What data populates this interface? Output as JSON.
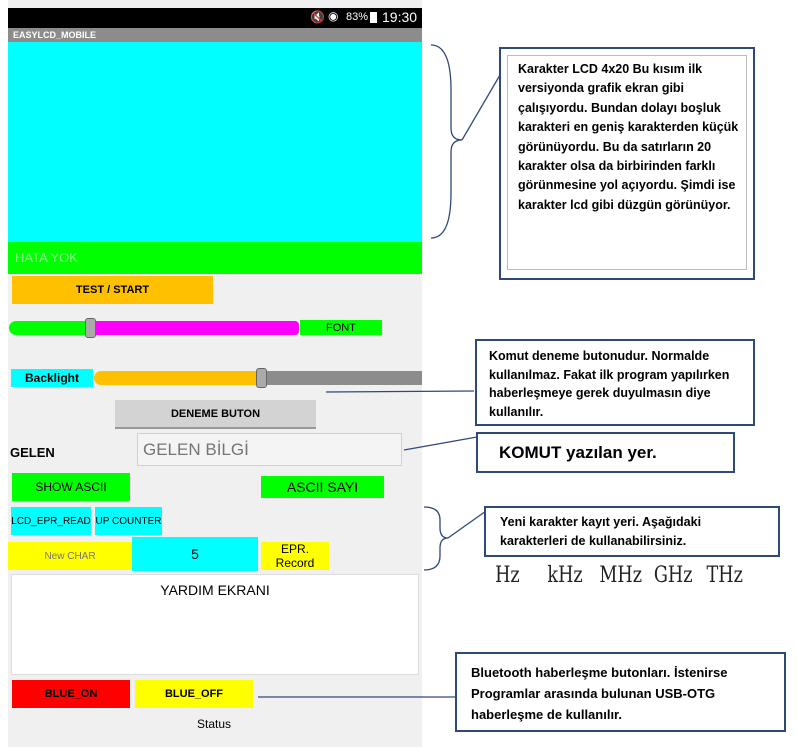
{
  "statusbar": {
    "battery": "83%",
    "time": "19:30"
  },
  "app": {
    "title": "EASYLCD_MOBILE"
  },
  "error": {
    "text": "HATA YOK"
  },
  "buttons": {
    "test_start": "TEST / START",
    "font": "FONT",
    "deneme": "DENEME BUTON",
    "show_ascii": "SHOW ASCII",
    "ascii_sayi": "ASCII SAYI",
    "lcd_epr_read": "LCD_EPR_READ",
    "up_counter": "UP COUNTER",
    "new_char": "New CHAR",
    "epr_record": "EPR. Record",
    "blue_on": "BLUE_ON",
    "blue_off": "BLUE_OFF"
  },
  "labels": {
    "backlight": "Backlight",
    "gelen": "GELEN",
    "yardim": "YARDIM EKRANI",
    "status": "Status"
  },
  "inputs": {
    "gelen_placeholder": "GELEN BİLGİ",
    "counter_value": "5"
  },
  "sliders": {
    "font_level": 0.28,
    "backlight_level": 0.51
  },
  "units": [
    "Hz",
    "kHz",
    "MHz",
    "GHz",
    "THz"
  ],
  "callouts": {
    "lcd": "Karakter LCD 4x20  Bu kısım ilk versiyonda grafik ekran gibi çalışıyordu. Bundan dolayı boşluk karakteri en geniş karakterden küçük görünüyordu. Bu da satırların 20 karakter olsa da birbirinden farklı görünmesine yol açıyordu. Şimdi ise karakter lcd gibi düzgün görünüyor.",
    "deneme": "Komut deneme butonudur. Normalde kullanılmaz. Fakat ilk program yapılırken haberleşmeye gerek duyulmasın diye kullanılır.",
    "komut": "KOMUT yazılan yer.",
    "karakter": "Yeni karakter kayıt yeri. Aşağıdaki karakterleri  de kullanabilirsiniz.",
    "bluetooth": "Bluetooth haberleşme butonları. İstenirse  Programlar arasında bulunan USB-OTG  haberleşme  de kullanılır."
  },
  "colors": {
    "cyan": "#00ffff",
    "green": "#00ff00",
    "magenta": "#ff00ff",
    "orange": "#ffc000",
    "yellow": "#ffff00",
    "red": "#ff0000",
    "callout_border": "#2e4a7a"
  }
}
